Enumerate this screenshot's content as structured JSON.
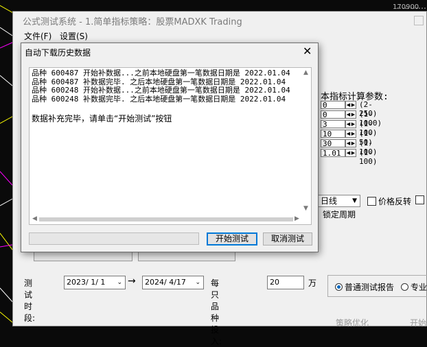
{
  "background": {
    "price_label": "170900"
  },
  "main_window": {
    "title": "公式测试系统 - 1.简单指标策略：股票MADXK Trading",
    "menu": [
      "文件(F)",
      "设置(S)"
    ]
  },
  "params": {
    "title": "本指标计算参数:",
    "rows": [
      {
        "value": "0",
        "range": "(2-250)"
      },
      {
        "value": "0",
        "range": "(1-1000)"
      },
      {
        "value": "3",
        "range": "(1-100)"
      },
      {
        "value": "10",
        "range": "(1-50)"
      },
      {
        "value": "30",
        "range": "(1-100)"
      },
      {
        "value": "1.01",
        "range": "(1-100)"
      }
    ]
  },
  "options": {
    "cycle": "日线",
    "lock_cycle": "锁定周期",
    "price_reverse": "价格反转",
    "price_reverse_checked": false
  },
  "test_period": {
    "label": "测试时段:",
    "start": "2023/ 1/ 1",
    "arrow": "→",
    "end": "2024/ 4/17",
    "invest_label": "每只品种投入:",
    "invest_value": "20",
    "unit": "万"
  },
  "report": {
    "normal": "普通测试报告",
    "pro": "专业",
    "selected": "normal"
  },
  "footer": {
    "optimize": "策略优化",
    "start": "开始"
  },
  "dialog": {
    "title": "自动下载历史数据",
    "log_lines": [
      "品种 600487 开始补数据...之前本地硬盘第一笔数据日期是 2022.01.04",
      "品种 600487 补数据完毕. 之后本地硬盘第一笔数据日期是 2022.01.04",
      "品种 600248 开始补数据...之前本地硬盘第一笔数据日期是 2022.01.04",
      "品种 600248 补数据完毕. 之后本地硬盘第一笔数据日期是 2022.01.04"
    ],
    "message": "数据补充完毕，请单击“开始测试”按钮",
    "progress": 0,
    "start_button": "开始测试",
    "cancel_button": "取消测试"
  }
}
